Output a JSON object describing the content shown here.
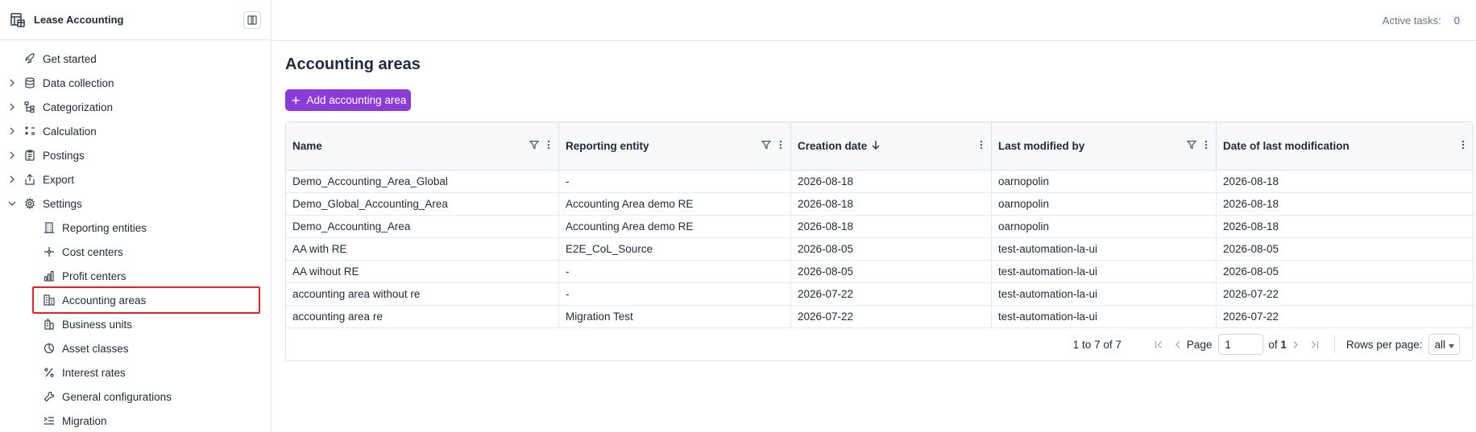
{
  "app": {
    "title": "Lease Accounting"
  },
  "topbar": {
    "active_tasks_label": "Active tasks:",
    "active_tasks_count": "0"
  },
  "sidebar": {
    "items": [
      {
        "label": "Get started",
        "icon": "rocket-icon",
        "expandable": false
      },
      {
        "label": "Data collection",
        "icon": "database-icon",
        "expandable": true
      },
      {
        "label": "Categorization",
        "icon": "hierarchy-icon",
        "expandable": true
      },
      {
        "label": "Calculation",
        "icon": "calculator-icon",
        "expandable": true
      },
      {
        "label": "Postings",
        "icon": "clipboard-icon",
        "expandable": true
      },
      {
        "label": "Export",
        "icon": "export-icon",
        "expandable": true
      },
      {
        "label": "Settings",
        "icon": "gear-icon",
        "expandable": true,
        "expanded": true
      }
    ],
    "settings_children": [
      {
        "label": "Reporting entities",
        "icon": "building-icon"
      },
      {
        "label": "Cost centers",
        "icon": "cost-center-icon"
      },
      {
        "label": "Profit centers",
        "icon": "bar-chart-icon"
      },
      {
        "label": "Accounting areas",
        "icon": "accounting-area-icon",
        "active": true
      },
      {
        "label": "Business units",
        "icon": "business-unit-icon"
      },
      {
        "label": "Asset classes",
        "icon": "pie-chart-icon"
      },
      {
        "label": "Interest rates",
        "icon": "percent-icon"
      },
      {
        "label": "General configurations",
        "icon": "wrench-icon"
      },
      {
        "label": "Migration",
        "icon": "migration-icon"
      }
    ]
  },
  "main": {
    "title": "Accounting areas",
    "add_button_label": "Add accounting area",
    "table": {
      "columns": [
        {
          "label": "Name",
          "filter": true
        },
        {
          "label": "Reporting entity",
          "filter": true
        },
        {
          "label": "Creation date",
          "sort": "desc"
        },
        {
          "label": "Last modified by",
          "filter": true
        },
        {
          "label": "Date of last modification"
        }
      ],
      "rows": [
        [
          "Demo_Accounting_Area_Global",
          "-",
          "2026-08-18",
          "oarnopolin",
          "2026-08-18"
        ],
        [
          "Demo_Global_Accounting_Area",
          "Accounting Area demo RE",
          "2026-08-18",
          "oarnopolin",
          "2026-08-18"
        ],
        [
          "Demo_Accounting_Area",
          "Accounting Area demo RE",
          "2026-08-18",
          "oarnopolin",
          "2026-08-18"
        ],
        [
          "AA with RE",
          "E2E_CoL_Source",
          "2026-08-05",
          "test-automation-la-ui",
          "2026-08-05"
        ],
        [
          "AA wihout RE",
          "-",
          "2026-08-05",
          "test-automation-la-ui",
          "2026-08-05"
        ],
        [
          "accounting area without re",
          "-",
          "2026-07-22",
          "test-automation-la-ui",
          "2026-07-22"
        ],
        [
          "accounting area re",
          "Migration Test",
          "2026-07-22",
          "test-automation-la-ui",
          "2026-07-22"
        ]
      ]
    },
    "pagination": {
      "range_text": "1 to 7 of 7",
      "page_label": "Page",
      "page_value": "1",
      "of_label": "of",
      "total_pages": "1",
      "rows_per_page_label": "Rows per page:",
      "rows_per_page_value": "all"
    }
  },
  "colors": {
    "accent": "#8b3bd8",
    "highlight": "#d9262b"
  }
}
